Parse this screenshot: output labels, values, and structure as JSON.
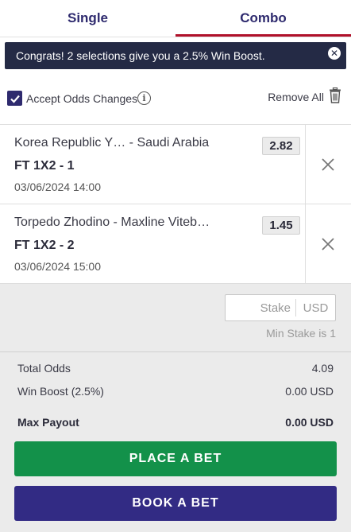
{
  "tabs": [
    {
      "label": "Single",
      "active": false
    },
    {
      "label": "Combo",
      "active": true
    }
  ],
  "banner": {
    "text": "Congrats! 2 selections give you a 2.5% Win Boost."
  },
  "options": {
    "accept_odds_label": "Accept Odds Changes",
    "accept_odds_checked": true,
    "remove_all_label": "Remove All"
  },
  "bets": [
    {
      "teams": "Korea Republic Y…  - Saudi Arabia",
      "market": "FT 1X2 - 1",
      "datetime": "03/06/2024 14:00",
      "odds": "2.82"
    },
    {
      "teams": "Torpedo Zhodino  - Maxline Viteb…",
      "market": "FT 1X2 - 2",
      "datetime": "03/06/2024 15:00",
      "odds": "1.45"
    }
  ],
  "stake": {
    "placeholder": "Stake",
    "value": "",
    "currency": "USD",
    "min_note": "Min Stake is 1"
  },
  "summary": {
    "total_odds_label": "Total Odds",
    "total_odds_value": "4.09",
    "win_boost_label": "Win Boost (2.5%)",
    "win_boost_value": "0.00 USD",
    "max_payout_label": "Max Payout",
    "max_payout_value": "0.00 USD"
  },
  "actions": {
    "place_label": "PLACE A BET",
    "book_label": "BOOK A BET"
  },
  "colors": {
    "brand_navy": "#2e2a6e",
    "tab_accent": "#b0112a",
    "banner_bg": "#242a45",
    "place_green": "#13914a",
    "book_purple": "#322b84"
  },
  "icons": {
    "checkbox": "checkmark-icon",
    "info": "info-icon",
    "trash": "trash-icon",
    "remove_selection": "close-icon",
    "banner_close": "close-circle-icon"
  }
}
